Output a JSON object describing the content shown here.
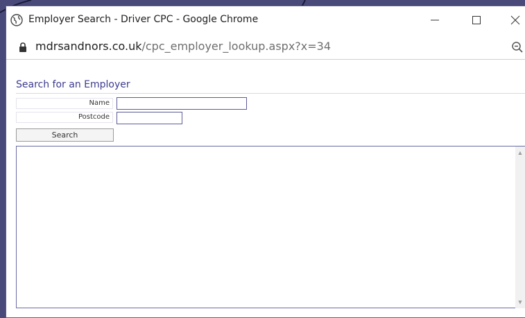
{
  "window": {
    "title": "Employer Search - Driver CPC - Google Chrome",
    "controls": {
      "minimize": "—",
      "maximize": "☐",
      "close": "✕"
    }
  },
  "address": {
    "host": "mdrsandnors.co.uk",
    "path": "/cpc_employer_lookup.aspx?x=34"
  },
  "page": {
    "title": "Search for an Employer",
    "form": {
      "name_label": "Name",
      "name_value": "",
      "postcode_label": "Postcode",
      "postcode_value": "",
      "search_label": "Search"
    }
  },
  "colors": {
    "accent": "#3b3b8f",
    "border": "#6a6aa8",
    "backdrop": "#4a4a7a"
  },
  "icons": [
    "globe-icon",
    "lock-icon",
    "zoom-out-icon",
    "scroll-up-arrow-icon",
    "scroll-down-arrow-icon"
  ]
}
